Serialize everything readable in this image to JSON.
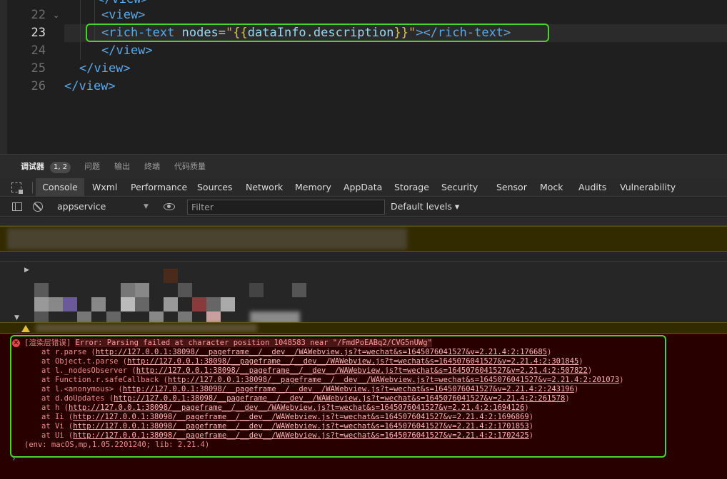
{
  "editor": {
    "lines": [
      {
        "num": "22",
        "indent": "  ",
        "code": "<view>"
      },
      {
        "num": "23",
        "indent": "    ",
        "code": "<rich-text nodes=\"{{dataInfo.description}}\"></rich-text>"
      },
      {
        "num": "24",
        "indent": "  ",
        "code": "</view>"
      },
      {
        "num": "25",
        "indent": "",
        "code": "</view>"
      },
      {
        "num": "26",
        "indent": "",
        "code": "</view>"
      }
    ],
    "line23": {
      "open_tag": "<rich-text",
      "attr": "nodes",
      "eq": "=",
      "quote": "\"",
      "brace_open": "{{",
      "expr": "dataInfo.description",
      "brace_close": "}}",
      "close_tag": "></rich-text>"
    }
  },
  "bottom_tabs": {
    "debugger": "调试器",
    "badge": "1, 2",
    "problems": "问题",
    "output": "输出",
    "terminal": "终端",
    "code_quality": "代码质量"
  },
  "devtools_tabs": [
    "Console",
    "Wxml",
    "Performance",
    "Sources",
    "Network",
    "Memory",
    "AppData",
    "Storage",
    "Security",
    "Sensor",
    "Mock",
    "Audits",
    "Vulnerability"
  ],
  "toolbar": {
    "context": "appservice",
    "filter_placeholder": "Filter",
    "levels": "Default levels ▾"
  },
  "console": {
    "error_prefix": "[渲染层错误]",
    "error_message": "Error: Parsing failed at character position 1048583 near \"/FmdPoEABq2/CVG5nUWg\"",
    "stack": [
      {
        "at": "at r.parse (",
        "url": "http://127.0.0.1:38098/__pageframe__/__dev__/WAWebview.js?t=wechat&s=1645076041527&v=2.21.4:2:176685",
        "end": ")"
      },
      {
        "at": "at Object.t.parse (",
        "url": "http://127.0.0.1:38098/__pageframe__/__dev__/WAWebview.js?t=wechat&s=1645076041527&v=2.21.4:2:301845",
        "end": ")"
      },
      {
        "at": "at l._nodesObserver (",
        "url": "http://127.0.0.1:38098/__pageframe__/__dev__/WAWebview.js?t=wechat&s=1645076041527&v=2.21.4:2:507822",
        "end": ")"
      },
      {
        "at": "at Function.r.safeCallback (",
        "url": "http://127.0.0.1:38098/__pageframe__/__dev__/WAWebview.js?t=wechat&s=1645076041527&v=2.21.4:2:201073",
        "end": ")"
      },
      {
        "at": "at l.<anonymous> (",
        "url": "http://127.0.0.1:38098/__pageframe__/__dev__/WAWebview.js?t=wechat&s=1645076041527&v=2.21.4:2:243196",
        "end": ")"
      },
      {
        "at": "at d.doUpdates (",
        "url": "http://127.0.0.1:38098/__pageframe__/__dev__/WAWebview.js?t=wechat&s=1645076041527&v=2.21.4:2:261578",
        "end": ")"
      },
      {
        "at": "at h (",
        "url": "http://127.0.0.1:38098/__pageframe__/__dev__/WAWebview.js?t=wechat&s=1645076041527&v=2.21.4:2:1694126",
        "end": ")"
      },
      {
        "at": "at Ii (",
        "url": "http://127.0.0.1:38098/__pageframe__/__dev__/WAWebview.js?t=wechat&s=1645076041527&v=2.21.4:2:1696869",
        "end": ")"
      },
      {
        "at": "at Vi (",
        "url": "http://127.0.0.1:38098/__pageframe__/__dev__/WAWebview.js?t=wechat&s=1645076041527&v=2.21.4:2:1701853",
        "end": ")"
      },
      {
        "at": "at Ui (",
        "url": "http://127.0.0.1:38098/__pageframe__/__dev__/WAWebview.js?t=wechat&s=1645076041527&v=2.21.4:2:1702425",
        "end": ")"
      }
    ],
    "env": "(env: macOS,mp,1.05.2201240; lib: 2.21.4)",
    "prompt": "›"
  },
  "colors": {
    "highlight_box": "#4cd32b",
    "error_bg": "#290000",
    "error_text": "#f08a8a",
    "warn_bg": "#332b00"
  }
}
